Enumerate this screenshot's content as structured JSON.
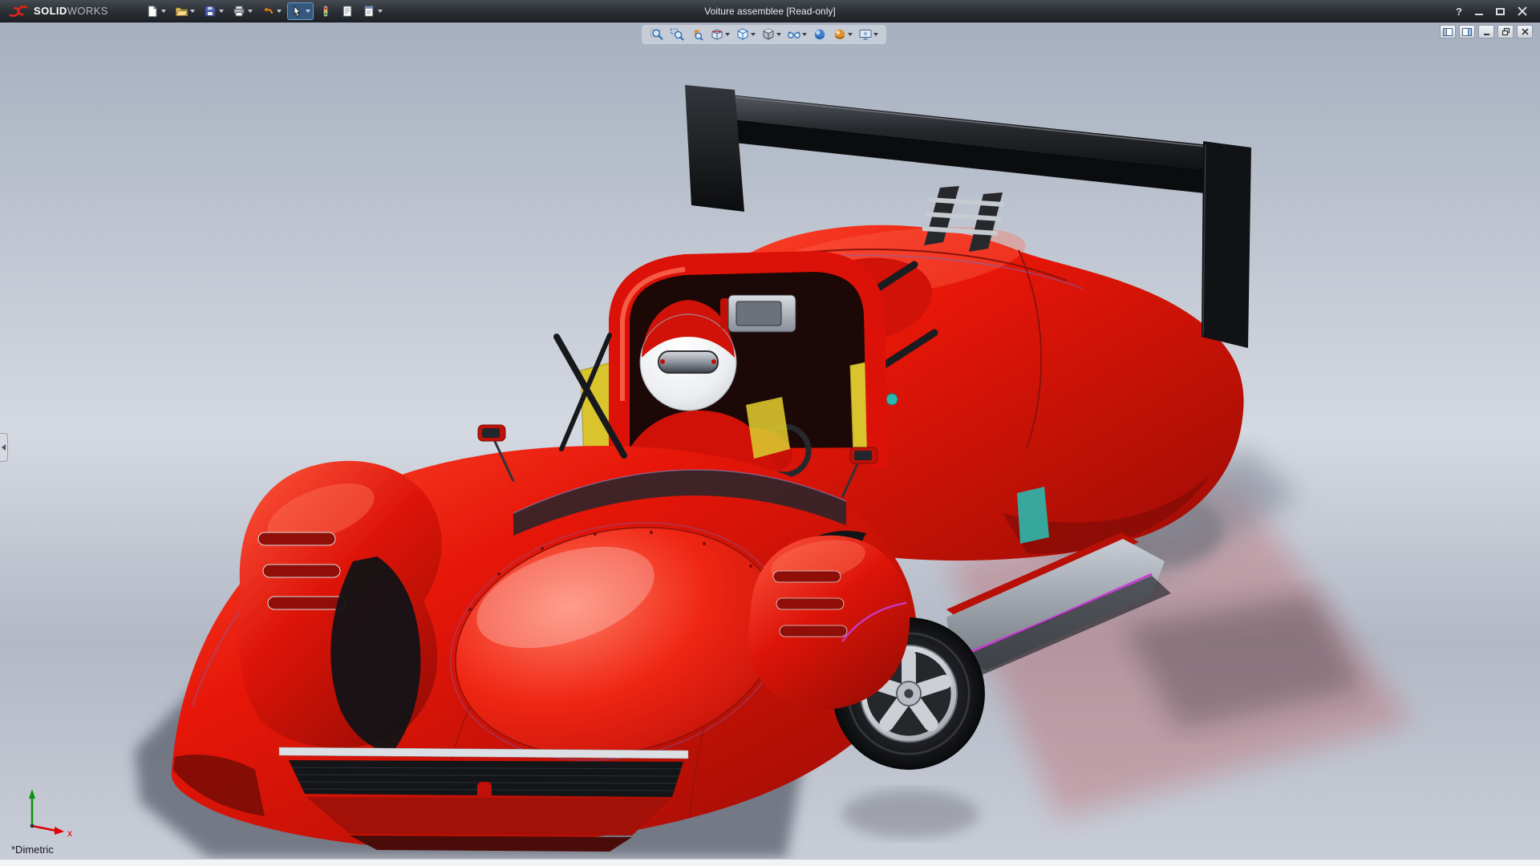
{
  "window": {
    "brand": {
      "solid": "SOLID",
      "works": "WORKS",
      "logo_accent": "#e2231a"
    },
    "title": "Voiture assemblee [Read-only]",
    "help_glyph": "?",
    "controls": [
      "help",
      "minimize",
      "maximize",
      "close"
    ]
  },
  "main_toolbar": {
    "items": [
      {
        "name": "new-document",
        "caret": true
      },
      {
        "name": "open-document",
        "caret": true
      },
      {
        "name": "save",
        "caret": true
      },
      {
        "name": "print",
        "caret": true
      },
      {
        "name": "undo",
        "caret": true
      },
      {
        "name": "select",
        "caret": true,
        "pressed": true
      },
      {
        "name": "rebuild",
        "caret": false
      },
      {
        "name": "file-properties",
        "caret": false
      },
      {
        "name": "options-sheet",
        "caret": true
      }
    ]
  },
  "heads_up_toolbar": {
    "items": [
      {
        "name": "zoom-to-fit",
        "caret": false
      },
      {
        "name": "zoom-to-area",
        "caret": false
      },
      {
        "name": "previous-view",
        "caret": false
      },
      {
        "name": "section-view",
        "caret": true
      },
      {
        "name": "view-orientation",
        "caret": true
      },
      {
        "name": "display-style",
        "caret": true
      },
      {
        "name": "hide-show-items",
        "caret": true
      },
      {
        "name": "edit-appearance",
        "caret": false
      },
      {
        "name": "apply-scene",
        "caret": true
      },
      {
        "name": "view-settings",
        "caret": true
      }
    ]
  },
  "document_controls": {
    "items": [
      "display-pane-left",
      "display-pane-right",
      "minimize-document",
      "restore-document",
      "close-document"
    ]
  },
  "viewport": {
    "orientation_label": "*Dimetric",
    "triad": {
      "x_label": "x",
      "x_color": "#e00000",
      "y_color": "#0a930a"
    },
    "background": {
      "top": "#a3adbd",
      "middle": "#d4d8e1",
      "bottom": "#c9cdd7"
    },
    "model": {
      "name": "voiture-assemblee",
      "description": "Red open-cockpit Le Mans prototype race car with black rear wing, roll hoop, driver in white/red helmet, silver 5-spoke wheels",
      "body_color": "#e11408",
      "wing_color": "#141517",
      "helmet_color": "#f2f3f5",
      "accent_yellow": "#d9c42d",
      "accent_teal": "#2bb8ae",
      "accent_magenta": "#c43fd0",
      "rim_color": "#c6c9ce"
    }
  }
}
